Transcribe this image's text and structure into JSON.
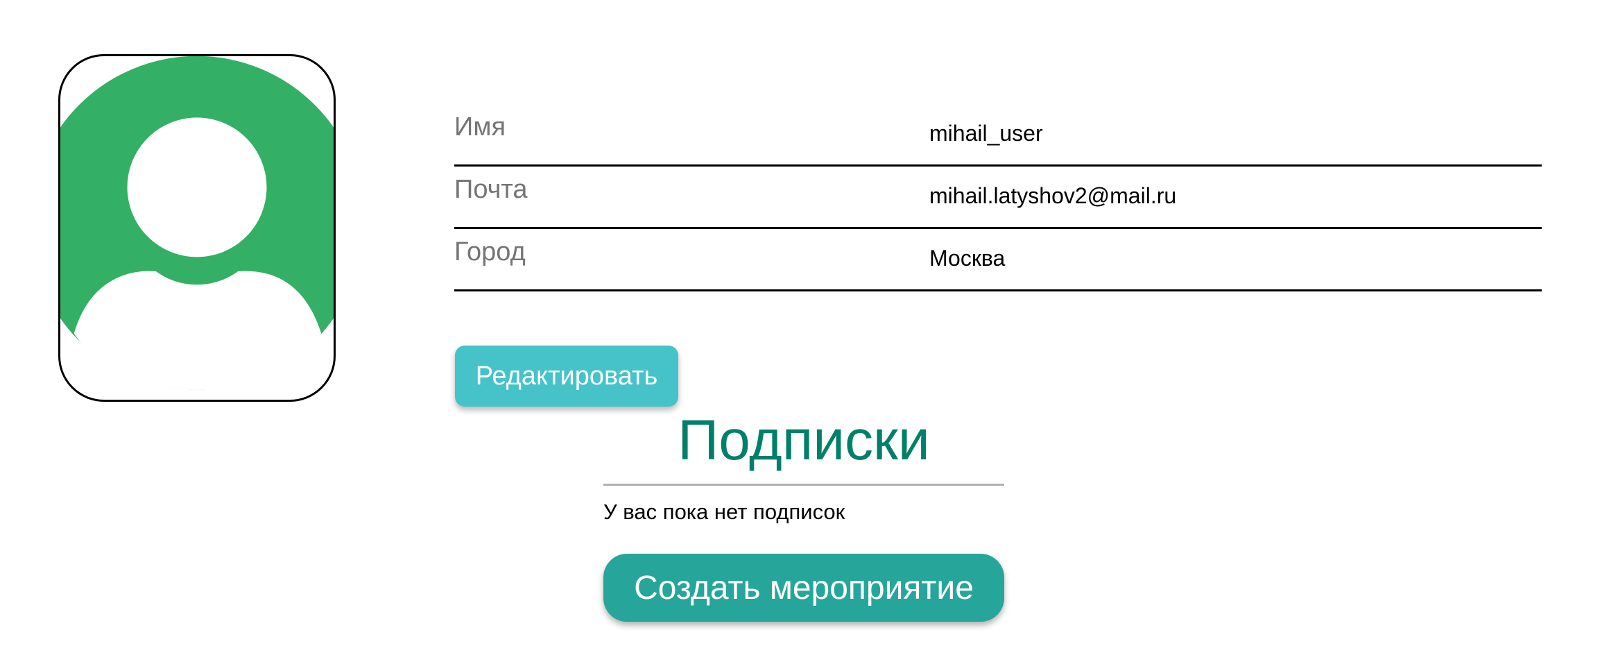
{
  "profile": {
    "avatar_icon": "user-avatar-icon",
    "avatar_color": "#33b066",
    "fields": [
      {
        "label": "Имя",
        "value": "mihail_user"
      },
      {
        "label": "Почта",
        "value": "mihail.latyshov2@mail.ru"
      },
      {
        "label": "Город",
        "value": "Москва"
      }
    ],
    "edit_label": "Редактировать",
    "edit_color": "#45c3c8"
  },
  "subscriptions": {
    "title": "Подписки",
    "title_color": "#00806a",
    "empty_text": "У вас пока нет подписок",
    "create_label": "Создать мероприятие",
    "create_color": "#26a69a"
  }
}
